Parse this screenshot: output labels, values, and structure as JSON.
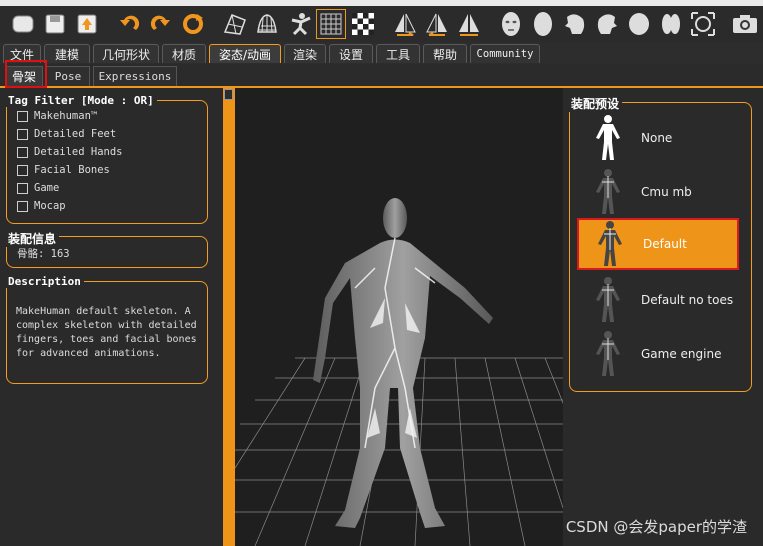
{
  "toolbar": {
    "icons": [
      "new-file",
      "save",
      "export",
      "undo",
      "redo",
      "reset",
      "wireframe",
      "smooth",
      "pose",
      "grid",
      "checker",
      "symmetry-right",
      "symmetry-left",
      "symmetry",
      "front-view",
      "back-view",
      "left-view",
      "right-view",
      "top-view",
      "bottom-view",
      "reset-camera",
      "screenshot"
    ]
  },
  "menu": {
    "tabs": [
      "文件",
      "建模",
      "几何形状",
      "材质",
      "姿态/动画",
      "渲染",
      "设置",
      "工具",
      "帮助",
      "Community"
    ],
    "active": "姿态/动画"
  },
  "subtabs": {
    "tabs": [
      "骨架",
      "Pose",
      "Expressions"
    ],
    "active": "骨架"
  },
  "tag_filter": {
    "title": "Tag Filter [Mode : OR]",
    "items": [
      "Makehuman™",
      "Detailed Feet",
      "Detailed Hands",
      "Facial Bones",
      "Game",
      "Mocap"
    ]
  },
  "rig_info": {
    "title": "装配信息",
    "bones_text": "骨骼: 163"
  },
  "description": {
    "title": "Description",
    "text": "MakeHuman default skeleton. A complex skeleton with detailed fingers, toes and facial bones for advanced animations."
  },
  "presets": {
    "title": "装配预设",
    "items": [
      "None",
      "Cmu mb",
      "Default",
      "Default no toes",
      "Game engine"
    ],
    "selected": "Default"
  },
  "watermark": "CSDN @会发paper的学渣",
  "colors": {
    "accent": "#ee9418",
    "highlight": "#e01010",
    "panel": "#2a2a2a"
  }
}
